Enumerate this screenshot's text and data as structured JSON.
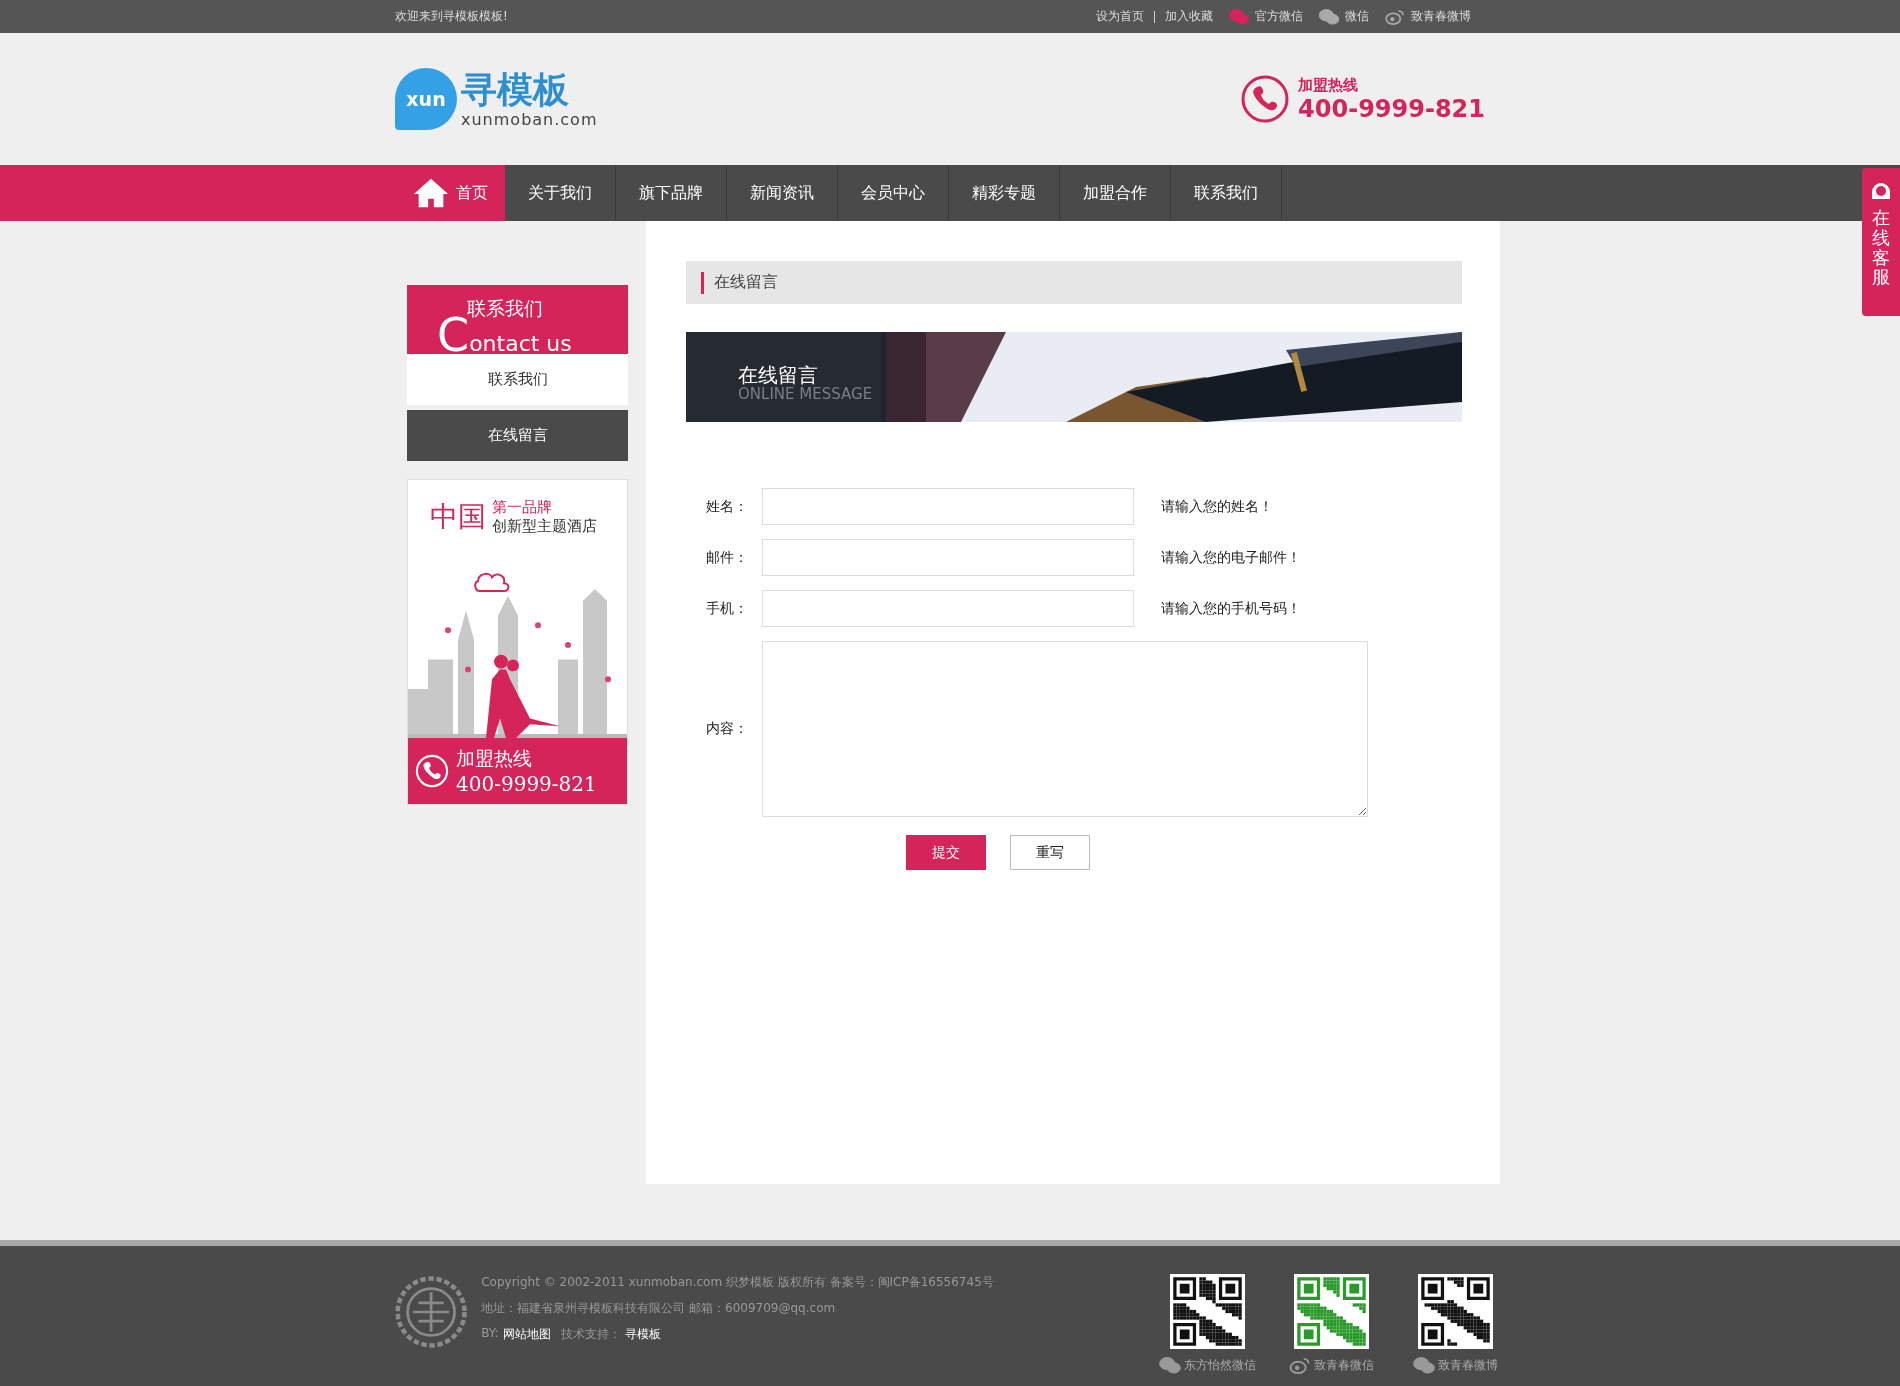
{
  "top_bar": {
    "welcome": "欢迎来到寻模板模板!",
    "links": [
      {
        "label": "设为首页",
        "kind": "plain"
      },
      {
        "label": "加入收藏",
        "kind": "plain"
      },
      {
        "label": "官方微信",
        "kind": "wechat",
        "highlighted": true
      },
      {
        "label": "微信",
        "kind": "wechat",
        "highlighted": false
      },
      {
        "label": "致青春微博",
        "kind": "weibo",
        "highlighted": false
      }
    ]
  },
  "header": {
    "logo": {
      "badge": "xun",
      "name": "寻模板",
      "domain": "xunmoban.com"
    },
    "hotline": {
      "label": "加盟热线",
      "number": "400-9999-821"
    }
  },
  "nav": [
    {
      "label": "首页",
      "selected": true,
      "kind": "home"
    },
    {
      "label": "关于我们",
      "selected": false
    },
    {
      "label": "旗下品牌",
      "selected": false
    },
    {
      "label": "新闻资讯",
      "selected": false
    },
    {
      "label": "会员中心",
      "selected": false
    },
    {
      "label": "精彩专题",
      "selected": false
    },
    {
      "label": "加盟合作",
      "selected": false
    },
    {
      "label": "联系我们",
      "selected": false
    }
  ],
  "side_tab": {
    "label": "在线客服"
  },
  "sidebar": {
    "title_cn": "联系我们",
    "title_en": "Contact us",
    "items": [
      {
        "label": "联系我们",
        "selected": false
      },
      {
        "label": "在线留言",
        "selected": true
      }
    ],
    "ad": {
      "kicker": "中国",
      "tag": "第一品牌",
      "subtitle": "创新型主题酒店",
      "hotline_label": "加盟热线",
      "hotline": "400-9999-821"
    }
  },
  "main": {
    "title": "在线留言",
    "banner": {
      "title": "在线留言",
      "subtitle": "ONLINE MESSAGE"
    },
    "fields": [
      {
        "label": "姓名：",
        "kind": "input",
        "hint": "请输入您的姓名！"
      },
      {
        "label": "邮件：",
        "kind": "input",
        "hint": "请输入您的电子邮件！"
      },
      {
        "label": "手机：",
        "kind": "input",
        "hint": "请输入您的手机号码！"
      },
      {
        "label": "内容：",
        "kind": "textarea"
      }
    ],
    "buttons": [
      {
        "label": "提交",
        "kind": "primary"
      },
      {
        "label": "重写",
        "kind": "secondary"
      }
    ]
  },
  "footer": {
    "lines": [
      "Copyright © 2002-2011 xunmoban.com 织梦模板 版权所有 备案号：闽ICP备16556745号",
      "地址：福建省泉州寻模板科技有限公司 邮箱：6009709@qq.com"
    ],
    "credits": [
      {
        "text": "BY:",
        "kind": "label"
      },
      {
        "text": "网站地图",
        "kind": "link"
      },
      {
        "text": "技术支持：",
        "kind": "label"
      },
      {
        "text": "寻模板",
        "kind": "link"
      }
    ],
    "qr_codes": [
      {
        "caption": "东方怡然微信",
        "kind": "wechat",
        "color": "#111111"
      },
      {
        "caption": "致青春微信",
        "kind": "weibo",
        "color": "#2a9a2a"
      },
      {
        "caption": "致青春微博",
        "kind": "wechat",
        "color": "#111111"
      }
    ]
  }
}
